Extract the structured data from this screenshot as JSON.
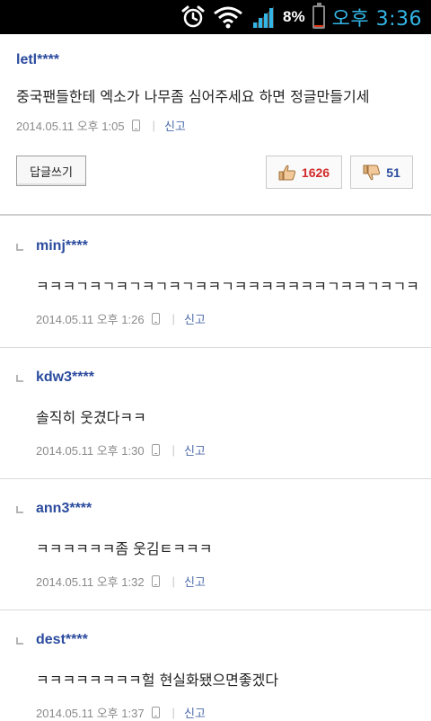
{
  "status_bar": {
    "battery_percent": "8%",
    "battery_level": 0.08,
    "time": "오후 3:36",
    "icons": [
      "alarm-icon",
      "wifi-icon",
      "signal-icon",
      "battery-icon"
    ]
  },
  "main_comment": {
    "author": "letl****",
    "text": "중국팬들한테 엑소가 나무좀 심어주세요 하면 정글만들기세",
    "date": "2014.05.11 오후 1:05",
    "report_label": "신고",
    "reply_button": "답글쓰기",
    "likes": "1626",
    "dislikes": "51"
  },
  "replies": [
    {
      "author": "minj****",
      "text": "ㅋㅋㅋㄱㅋㄱㅋㄱㅋㄱㅋㄱㅋㅋㄱㅋㅋㅋㅋㅋㅋㅋㄱㅋㅋㄱㅋㄱㅋ",
      "date": "2014.05.11 오후 1:26",
      "report_label": "신고"
    },
    {
      "author": "kdw3****",
      "text": "솔직히 웃겼다ㅋㅋ",
      "date": "2014.05.11 오후 1:30",
      "report_label": "신고"
    },
    {
      "author": "ann3****",
      "text": "ㅋㅋㅋㅋㅋㅋ좀 웃김ㅌㅋㅋㅋ",
      "date": "2014.05.11 오후 1:32",
      "report_label": "신고"
    },
    {
      "author": "dest****",
      "text": "ㅋㅋㅋㅋㅋㅋㅋㅋ헐 현실화됐으면좋겠다",
      "date": "2014.05.11 오후 1:37",
      "report_label": "신고"
    }
  ],
  "colors": {
    "author": "#2b4b9e",
    "like": "#d42a2a",
    "dislike": "#2b4b9e",
    "clock": "#33b5e5"
  }
}
